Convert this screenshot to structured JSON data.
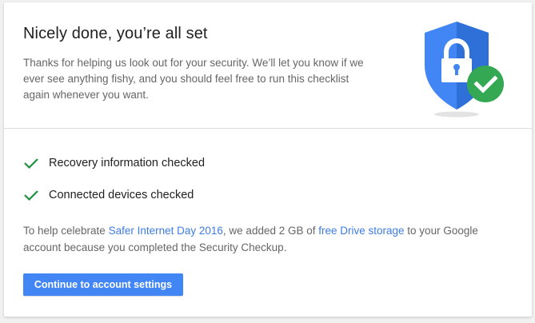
{
  "header": {
    "title": "Nicely done, you’re all set",
    "intro": "Thanks for helping us look out for your security. We’ll let you know if we ever see anything fishy, and you should feel free to run this checklist again whenever you want."
  },
  "checklist": [
    {
      "label": "Recovery information checked",
      "icon": "checkmark-icon"
    },
    {
      "label": "Connected devices checked",
      "icon": "checkmark-icon"
    }
  ],
  "note": {
    "part1": "To help celebrate ",
    "link1": "Safer Internet Day 2016",
    "part2": ", we added 2 GB of ",
    "link2": "free Drive storage",
    "part3": " to your Google account because you completed the Security Checkup."
  },
  "actions": {
    "continue_label": "Continue to account settings"
  },
  "colors": {
    "accent": "#4285f4",
    "link": "#3d7ce6",
    "check": "#1e8e3e",
    "badge": "#34a853"
  }
}
